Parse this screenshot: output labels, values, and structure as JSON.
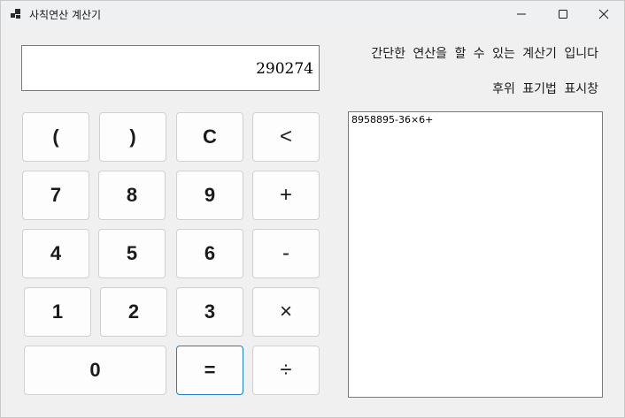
{
  "window": {
    "title": "사칙연산 계산기",
    "icons": {
      "app": "app-icon",
      "minimize": "minimize-icon",
      "maximize": "maximize-icon",
      "close": "close-icon"
    }
  },
  "display": {
    "value": "290274"
  },
  "keys": {
    "open_paren": "(",
    "close_paren": ")",
    "clear": "C",
    "backspace": "<",
    "seven": "7",
    "eight": "8",
    "nine": "9",
    "plus": "+",
    "four": "4",
    "five": "5",
    "six": "6",
    "minus": "-",
    "one": "1",
    "two": "2",
    "three": "3",
    "multiply": "×",
    "zero": "0",
    "equals": "=",
    "divide": "÷"
  },
  "description": "간단한 연산을 할 수 있는 계산기 입니다",
  "postfix": {
    "label": "후위 표기법 표시창",
    "content": "8958895-36×6+"
  },
  "colors": {
    "background": "#f0f0f0",
    "equals_border": "#1f7fc4"
  }
}
